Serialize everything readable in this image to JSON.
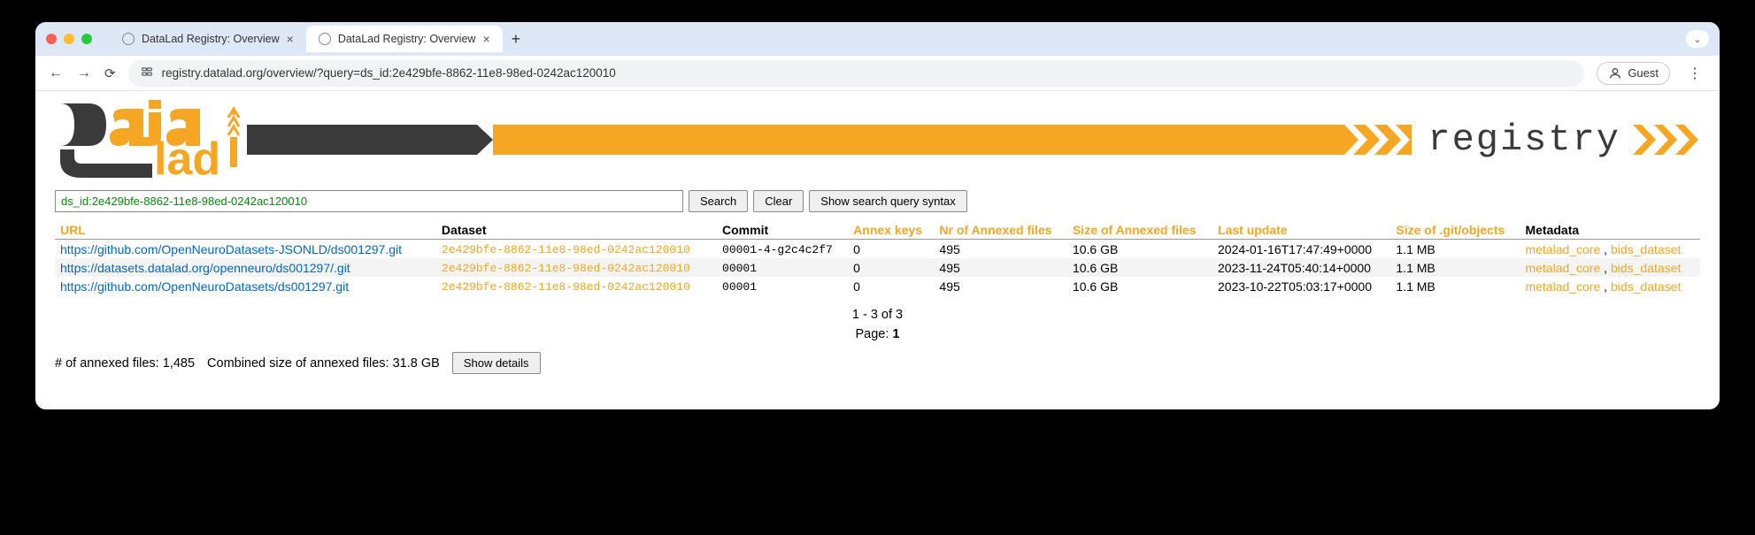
{
  "browser": {
    "tabs": [
      {
        "title": "DataLad Registry: Overview",
        "active": false
      },
      {
        "title": "DataLad Registry: Overview",
        "active": true
      }
    ],
    "url": "registry.datalad.org/overview/?query=ds_id:2e429bfe-8862-11e8-98ed-0242ac120010",
    "guest": "Guest"
  },
  "logo": {
    "registry_text": "registry"
  },
  "search": {
    "query": "ds_id:2e429bfe-8862-11e8-98ed-0242ac120010",
    "search_btn": "Search",
    "clear_btn": "Clear",
    "syntax_btn": "Show search query syntax"
  },
  "columns": {
    "url": "URL",
    "dataset": "Dataset",
    "commit": "Commit",
    "annex_keys": "Annex keys",
    "nr_annexed": "Nr of Annexed files",
    "size_annexed": "Size of Annexed files",
    "last_update": "Last update",
    "git_size": "Size of .git/objects",
    "metadata": "Metadata"
  },
  "rows": [
    {
      "url": "https://github.com/OpenNeuroDatasets-JSONLD/ds001297.git",
      "dataset": "2e429bfe-8862-11e8-98ed-0242ac120010",
      "commit": "00001-4-g2c4c2f7",
      "annex_keys": "0",
      "nr_annexed": "495",
      "size_annexed": "10.6 GB",
      "last_update": "2024-01-16T17:47:49+0000",
      "git_size": "1.1 MB",
      "meta1": "metalad_core",
      "meta2": "bids_dataset"
    },
    {
      "url": "https://datasets.datalad.org/openneuro/ds001297/.git",
      "dataset": "2e429bfe-8862-11e8-98ed-0242ac120010",
      "commit": "00001",
      "annex_keys": "0",
      "nr_annexed": "495",
      "size_annexed": "10.6 GB",
      "last_update": "2023-11-24T05:40:14+0000",
      "git_size": "1.1 MB",
      "meta1": "metalad_core",
      "meta2": "bids_dataset"
    },
    {
      "url": "https://github.com/OpenNeuroDatasets/ds001297.git",
      "dataset": "2e429bfe-8862-11e8-98ed-0242ac120010",
      "commit": "00001",
      "annex_keys": "0",
      "nr_annexed": "495",
      "size_annexed": "10.6 GB",
      "last_update": "2023-10-22T05:03:17+0000",
      "git_size": "1.1 MB",
      "meta1": "metalad_core",
      "meta2": "bids_dataset"
    }
  ],
  "paging": {
    "range": "1 - 3 of 3",
    "page_label": "Page: ",
    "page_num": "1"
  },
  "stats": {
    "annexed_label": "# of annexed files: ",
    "annexed_value": "1,485",
    "combined_label": "Combined size of annexed files: ",
    "combined_value": "31.8 GB",
    "details_btn": "Show details"
  }
}
